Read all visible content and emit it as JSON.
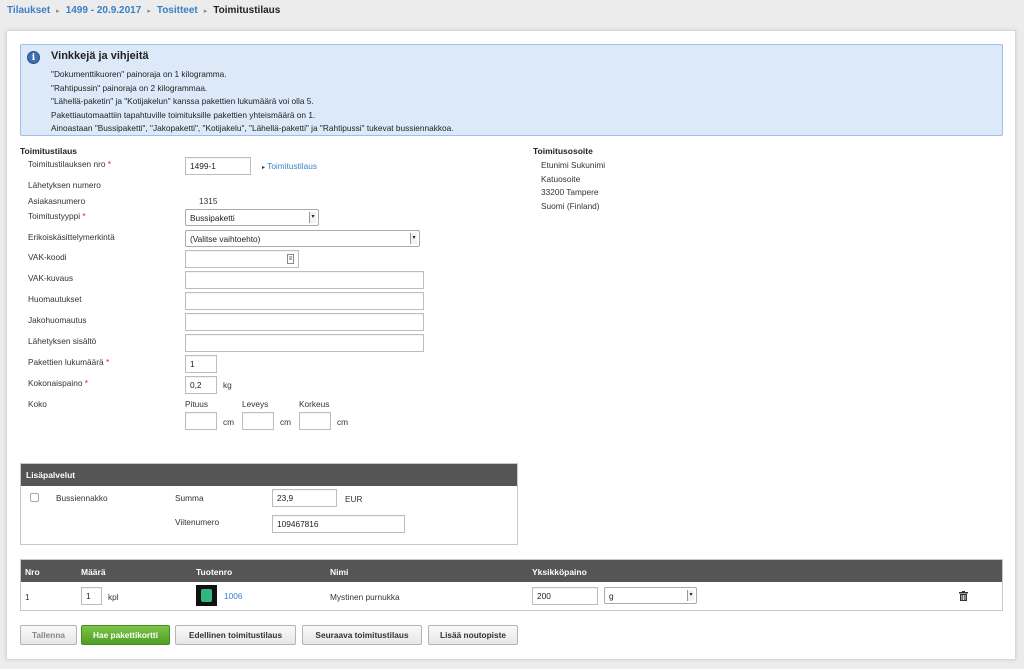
{
  "breadcrumb": [
    "Tilaukset",
    "1499 - 20.9.2017",
    "Tositteet",
    "Toimitustilaus"
  ],
  "info": {
    "title": "Vinkkejä ja vihjeitä",
    "lines": [
      "\"Dokumenttikuoren\" painoraja on 1 kilogramma.",
      "\"Rahtipussin\" painoraja on 2 kilogrammaa.",
      "\"Lähellä-paketin\" ja \"Kotijakelun\" kanssa pakettien lukumäärä voi olla 5.",
      "Pakettiautomaattiin tapahtuville toimituksille pakettien yhteismäärä on 1.",
      "Ainoastaan \"Bussipaketti\", \"Jakopaketti\", \"Kotijakelu\", \"Lähellä-paketti\" ja \"Rahtipussi\" tukevat bussiennakkoa."
    ]
  },
  "order": {
    "section_title": "Toimitustilaus",
    "order_no_label": "Toimitustilauksen nro",
    "order_no_value": "1499-1",
    "order_link": "Toimitustilaus",
    "shipment_no_label": "Lähetyksen numero",
    "customer_no_label": "Asiakasnumero",
    "customer_no_value": "1315",
    "delivery_type_label": "Toimitustyyppi",
    "delivery_type_value": "Bussipaketti",
    "special_label": "Erikoiskäsittelymerkintä",
    "special_value": "(Valitse vaihtoehto)",
    "vak_code_label": "VAK-koodi",
    "vak_desc_label": "VAK-kuvaus",
    "notes_label": "Huomautukset",
    "distribution_notes_label": "Jakohuomautus",
    "contents_label": "Lähetyksen sisältö",
    "packages_label": "Pakettien lukumäärä",
    "packages_value": "1",
    "weight_label": "Kokonaispaino",
    "weight_value": "0,2",
    "weight_unit": "kg",
    "size_label": "Koko",
    "length_label": "Pituus",
    "width_label": "Leveys",
    "height_label": "Korkeus",
    "cm": "cm",
    "required_mark": "*"
  },
  "address": {
    "title": "Toimitusosoite",
    "lines": [
      "Etunimi Sukunimi",
      "Katuosoite",
      "33200 Tampere",
      "Suomi (Finland)"
    ]
  },
  "services": {
    "title": "Lisäpalvelut",
    "cod_label": "Bussiennakko",
    "cod_checked": false,
    "sum_label": "Summa",
    "sum_value": "23,9",
    "currency": "EUR",
    "ref_label": "Viitenumero",
    "ref_value": "109467816"
  },
  "products": {
    "headers": [
      "Nro",
      "Määrä",
      "Tuotenro",
      "Nimi",
      "Yksikköpaino"
    ],
    "row": {
      "nro": "1",
      "qty": "1",
      "qty_unit": "kpl",
      "product_no": "1006",
      "name": "Mystinen purnukka",
      "unit_weight": "200",
      "weight_unit": "g"
    }
  },
  "buttons": {
    "save": "Tallenna",
    "get_card": "Hae pakettikortti",
    "prev": "Edellinen toimitustilaus",
    "next": "Seuraava toimitustilaus",
    "add_pickup": "Lisää noutopiste"
  },
  "colors": {
    "link": "#3a7fc6",
    "primary": "#5aab2d",
    "info_bg": "#dce9f8",
    "table_head": "#555555"
  }
}
